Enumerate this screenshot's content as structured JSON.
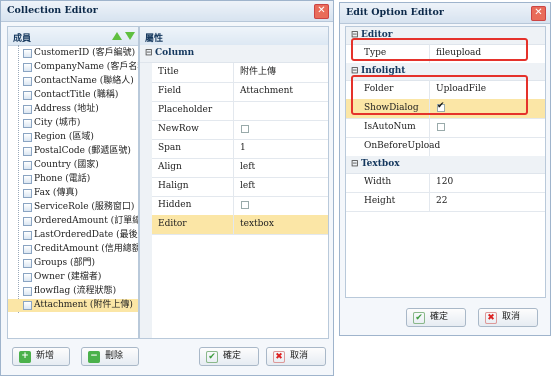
{
  "collection_editor": {
    "title": "Collection Editor",
    "members_header": "成員",
    "properties_header": "屬性",
    "members": [
      "CustomerID (客戶編號)",
      "CompanyName (客戶名稱)",
      "ContactName (聯絡人)",
      "ContactTitle (職稱)",
      "Address (地址)",
      "City (城市)",
      "Region (區域)",
      "PostalCode (郵遞區號)",
      "Country (國家)",
      "Phone (電話)",
      "Fax (傳真)",
      "ServiceRole (服務窗口)",
      "OrderedAmount (訂單總額)",
      "LastOrderedDate (最後訂單日",
      "CreditAmount (信用總額)",
      "Groups (部門)",
      "Owner (建檔者)",
      "flowflag (流程狀態)",
      "Attachment (附件上傳)"
    ],
    "selected_index": 18,
    "group_label": "Column",
    "properties": [
      {
        "key": "Title",
        "value": "附件上傳",
        "type": "text"
      },
      {
        "key": "Field",
        "value": "Attachment",
        "type": "text"
      },
      {
        "key": "Placeholder",
        "value": "",
        "type": "text"
      },
      {
        "key": "NewRow",
        "value": "",
        "type": "checkbox",
        "checked": false
      },
      {
        "key": "Span",
        "value": "1",
        "type": "text"
      },
      {
        "key": "Align",
        "value": "left",
        "type": "text"
      },
      {
        "key": "Halign",
        "value": "left",
        "type": "text"
      },
      {
        "key": "Hidden",
        "value": "",
        "type": "checkbox",
        "checked": false
      },
      {
        "key": "Editor",
        "value": "textbox",
        "type": "text",
        "highlight": true
      }
    ],
    "buttons": {
      "add": "新增",
      "delete": "刪除",
      "ok": "確定",
      "cancel": "取消"
    }
  },
  "option_editor": {
    "title": "Edit Option Editor",
    "groups": [
      {
        "label": "Editor",
        "rows": [
          {
            "key": "Type",
            "value": "fileupload",
            "type": "text"
          }
        ]
      },
      {
        "label": "Infolight",
        "rows": [
          {
            "key": "Folder",
            "value": "UploadFile",
            "type": "text"
          },
          {
            "key": "ShowDialog",
            "value": "",
            "type": "checkbox",
            "checked": true,
            "highlight": true
          },
          {
            "key": "IsAutoNum",
            "value": "",
            "type": "checkbox",
            "checked": false
          },
          {
            "key": "OnBeforeUpload",
            "value": "",
            "type": "text"
          }
        ]
      },
      {
        "label": "Textbox",
        "rows": [
          {
            "key": "Width",
            "value": "120",
            "type": "text"
          },
          {
            "key": "Height",
            "value": "22",
            "type": "text"
          }
        ]
      }
    ],
    "buttons": {
      "ok": "確定",
      "cancel": "取消"
    }
  },
  "colors": {
    "selection": "#fbe6a6",
    "annotation": "#e5322b",
    "header": "#dde8f3"
  }
}
